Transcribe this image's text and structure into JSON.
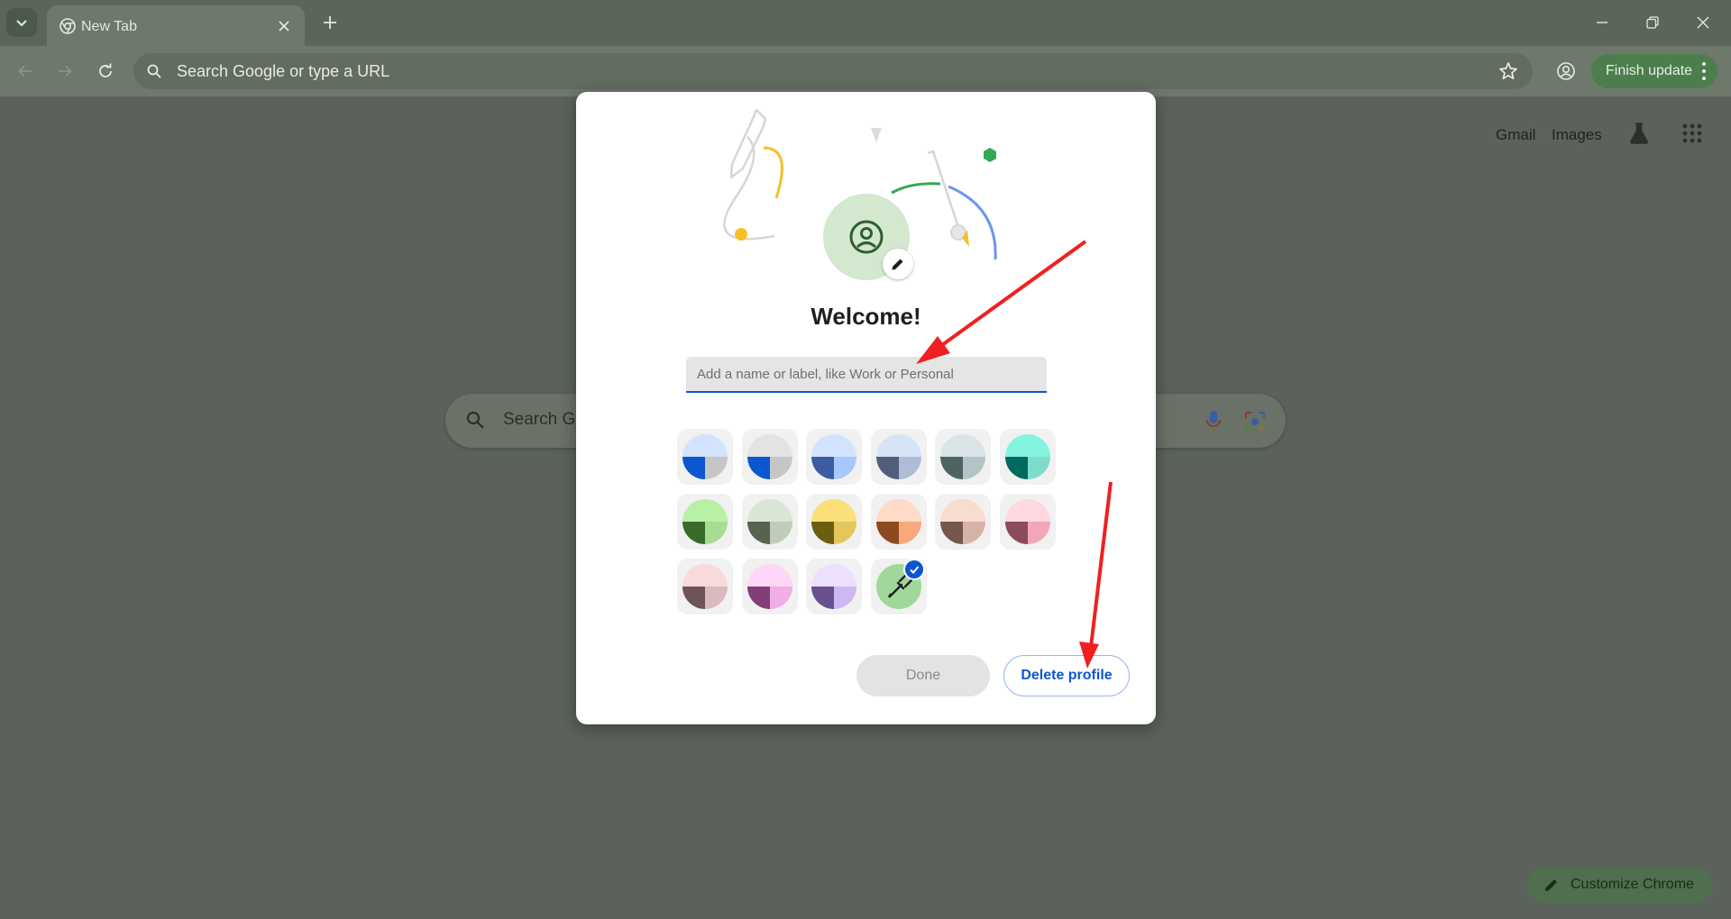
{
  "browser": {
    "tab": {
      "title": "New Tab"
    },
    "omnibox": {
      "placeholder": "Search Google or type a URL"
    },
    "finish_update_label": "Finish update"
  },
  "ntp": {
    "links": {
      "gmail": "Gmail",
      "images": "Images"
    },
    "search_placeholder": "Search Go",
    "customize_label": "Customize Chrome"
  },
  "dialog": {
    "title": "Welcome!",
    "name_input": {
      "placeholder": "Add a name or label, like Work or Personal",
      "value": ""
    },
    "color_swatches": [
      {
        "top": "#d3e3fd",
        "bl": "#0b57d0",
        "br": "#c4c7c5",
        "selected": false
      },
      {
        "top": "#e3e3e3",
        "bl": "#0b57d0",
        "br": "#c4c7c5",
        "selected": false
      },
      {
        "top": "#d3e3fd",
        "bl": "#3b5ca0",
        "br": "#a8c7fa",
        "selected": false
      },
      {
        "top": "#d7e3f7",
        "bl": "#515f7a",
        "br": "#aebcd6",
        "selected": false
      },
      {
        "top": "#d9e4e6",
        "bl": "#4f6365",
        "br": "#b3c4c6",
        "selected": false
      },
      {
        "top": "#84f4e0",
        "bl": "#006a5e",
        "br": "#7fdccb",
        "selected": false
      },
      {
        "top": "#b8f0a6",
        "bl": "#3a6a2a",
        "br": "#a7dc93",
        "selected": false
      },
      {
        "top": "#d9e6d5",
        "bl": "#57624f",
        "br": "#bfccb9",
        "selected": false
      },
      {
        "top": "#fbe07a",
        "bl": "#6d5e0f",
        "br": "#e3c75c",
        "selected": false
      },
      {
        "top": "#ffdbc7",
        "bl": "#8e4a1f",
        "br": "#f5a97c",
        "selected": false
      },
      {
        "top": "#f7dccf",
        "bl": "#77574b",
        "br": "#d6b3a6",
        "selected": false
      },
      {
        "top": "#ffd8e0",
        "bl": "#8d4a5a",
        "br": "#f3a6b8",
        "selected": false
      },
      {
        "top": "#f8dadd",
        "bl": "#6e5457",
        "br": "#dcb9bc",
        "selected": false
      },
      {
        "top": "#fdd7f5",
        "bl": "#803f78",
        "br": "#f0aee6",
        "selected": false
      },
      {
        "top": "#ece0fd",
        "bl": "#6a508f",
        "br": "#cdb8f3",
        "selected": false
      },
      {
        "top": "#9fd89a",
        "bl": "#9fd89a",
        "br": "#9fd89a",
        "selected": true,
        "icon": "eyedropper-icon"
      }
    ],
    "done_label": "Done",
    "delete_label": "Delete profile"
  },
  "colors": {
    "accent_blue": "#0b57d0",
    "annotation_arrow": "#f02020"
  }
}
